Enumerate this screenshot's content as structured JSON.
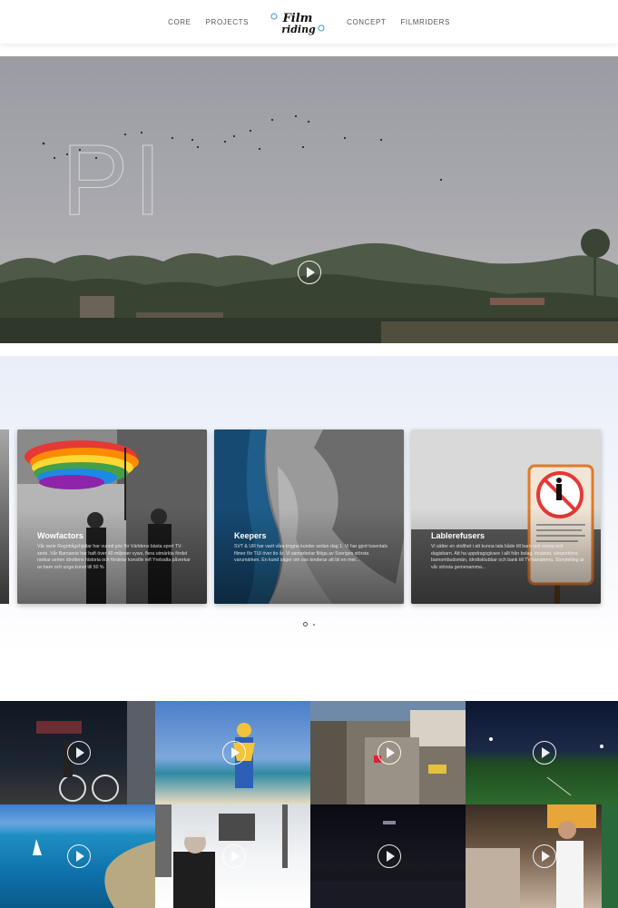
{
  "nav": {
    "items": [
      "CORE",
      "PROJECTS",
      "CONCEPT",
      "FILMRIDERS"
    ],
    "logo_text": "Film riding"
  },
  "hero": {
    "overlay_text": "PI"
  },
  "carousel": {
    "cards": [
      {
        "title": "Wowfactors",
        "description": "Vår serie Regnbågshjältar har vunnit pris för Världens bästa sport TV-serie. Vår Barnserie har haft över 40 miljoner vyws, flera utmärkta fördel rankar serien idrottens historia och fördelar konstliv mfl Yrelsalta påverkar av barn och unga konst till 50 %"
      },
      {
        "title": "Keepers",
        "description": "SVT & UR har varit våra trogna kunder sedan dag 1. Vi har gjort tusentals filmer för TUI över tio år. Vi samarbetar flitiga av Sveriges största varumärken. En kund säger om oss tenderar att bli en mer..."
      },
      {
        "title": "Lablerefusers",
        "description": "Vi sätter en stolthet i att kunna tala både till barn och vuxna och dagisbarn. Att ha uppdragsgivare i allt från bolag, insatser, vänportörer, barnombudsmän, idrottsklubbar och bank till TV-kanalerna. Storytelling är vår största gemenamma..."
      }
    ],
    "dots": 2,
    "active_dot": 0
  },
  "grid": {
    "tiles": [
      {
        "name": "night-cyclist",
        "play": true
      },
      {
        "name": "beach-mascot",
        "play": true
      },
      {
        "name": "aerial-street",
        "play": true
      },
      {
        "name": "night-field",
        "play": true
      },
      {
        "name": "aerial-coast",
        "play": true
      },
      {
        "name": "snow-forest",
        "play": true
      },
      {
        "name": "dark-room",
        "play": true
      },
      {
        "name": "restaurant",
        "play": true
      }
    ]
  }
}
